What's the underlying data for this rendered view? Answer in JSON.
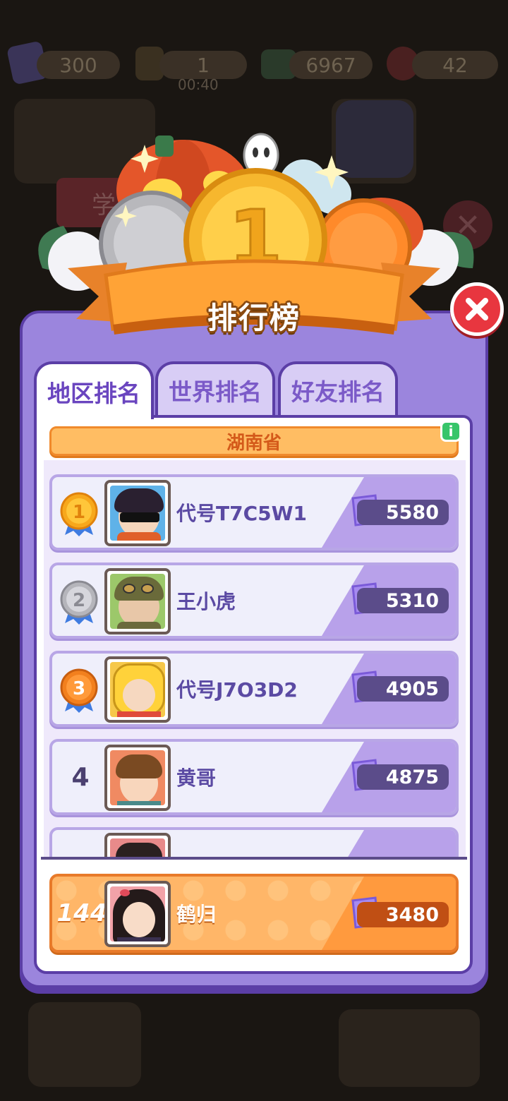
{
  "hud": {
    "tickets": "300",
    "energy": "1",
    "energy_timer": "00:40",
    "cash": "6967",
    "hearts": "42"
  },
  "background": {
    "side_tab": "学",
    "close": "✕"
  },
  "leaderboard": {
    "title": "排行榜",
    "close_label": "✕",
    "medal_center_number": "1",
    "tabs": [
      {
        "label": "地区排名",
        "active": true
      },
      {
        "label": "世界排名",
        "active": false
      },
      {
        "label": "好友排名",
        "active": false
      }
    ],
    "region": "湖南省",
    "info_icon": "i",
    "entries": [
      {
        "rank": "1",
        "medal": "gold-medal-icon",
        "name": "代号T7C5W1",
        "score": "5580",
        "avatar": "sunglasses-boy-avatar"
      },
      {
        "rank": "2",
        "medal": "silver-medal-icon",
        "name": "王小虎",
        "score": "5310",
        "avatar": "goggles-boy-avatar"
      },
      {
        "rank": "3",
        "medal": "bronze-medal-icon",
        "name": "代号J7O3D2",
        "score": "4905",
        "avatar": "yellow-hood-girl-avatar"
      },
      {
        "rank": "4",
        "medal": "",
        "name": "黄哥",
        "score": "4875",
        "avatar": "brown-hair-boy-avatar"
      }
    ],
    "self": {
      "rank": "144",
      "name": "鹤归",
      "score": "3480",
      "avatar": "black-hair-girl-avatar"
    }
  },
  "colors": {
    "panel": "#9b85dd",
    "panel_border": "#5b3ea6",
    "banner_orange": "#ffa336",
    "close_red": "#e8363f",
    "self_row": "#ffb668"
  }
}
